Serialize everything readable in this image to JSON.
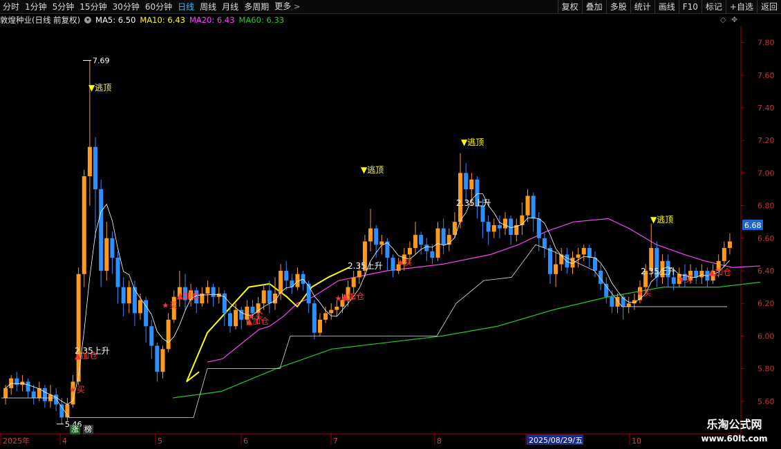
{
  "toolbar": {
    "tabs": [
      {
        "label": "分时",
        "active": false
      },
      {
        "label": "1分钟",
        "active": false
      },
      {
        "label": "5分钟",
        "active": false
      },
      {
        "label": "15分钟",
        "active": false
      },
      {
        "label": "30分钟",
        "active": false
      },
      {
        "label": "60分钟",
        "active": false
      },
      {
        "label": "日线",
        "active": true
      },
      {
        "label": "周线",
        "active": false
      },
      {
        "label": "月线",
        "active": false
      },
      {
        "label": "多周期",
        "active": false
      },
      {
        "label": "更多",
        "active": false
      }
    ],
    "tools": [
      "复权",
      "叠加",
      "多股",
      "统计",
      "画线",
      "F10",
      "标记",
      "+自选",
      "返回"
    ]
  },
  "info": {
    "stock_title": "敦煌种业(日线 前复权)",
    "ma5": "MA5: 6.50",
    "ma10": "MA10: 6.43",
    "ma20": "MA20: 6.43",
    "ma60": "MA60: 6.33"
  },
  "colors": {
    "up": "#ff9a1a",
    "down": "#2e8fff",
    "ma5": "#ffffff",
    "ma10": "#ffff00",
    "ma20": "#ff44ff",
    "ma60": "#22cc22",
    "axis": "#aa0000",
    "signal_red": "#ff3333",
    "signal_yellow": "#ffff00",
    "price_tag": "#1a66cc"
  },
  "chart_data": {
    "type": "candlestick",
    "ylim": [
      5.4,
      7.9
    ],
    "yticks": [
      "7.80",
      "7.60",
      "7.40",
      "7.20",
      "7.00",
      "6.80",
      "6.60",
      "6.40",
      "6.20",
      "6.00",
      "5.80",
      "5.60"
    ],
    "xlabels": [
      "2025年",
      "4",
      "5",
      "6",
      "7",
      "8",
      "9",
      "10"
    ],
    "highlight_date": "2025/08/29/五",
    "current_price": "6.68",
    "high_annotation": "7.69",
    "low_annotation": "5.46",
    "candles_ohlc": [
      [
        5.62,
        5.68,
        5.58,
        5.7
      ],
      [
        5.68,
        5.74,
        5.64,
        5.76
      ],
      [
        5.74,
        5.7,
        5.66,
        5.78
      ],
      [
        5.7,
        5.72,
        5.66,
        5.76
      ],
      [
        5.72,
        5.66,
        5.62,
        5.74
      ],
      [
        5.66,
        5.62,
        5.58,
        5.7
      ],
      [
        5.62,
        5.68,
        5.6,
        5.72
      ],
      [
        5.68,
        5.6,
        5.56,
        5.7
      ],
      [
        5.6,
        5.64,
        5.56,
        5.7
      ],
      [
        5.64,
        5.58,
        5.54,
        5.68
      ],
      [
        5.58,
        5.5,
        5.46,
        5.62
      ],
      [
        5.5,
        5.58,
        5.48,
        5.62
      ],
      [
        5.58,
        5.72,
        5.56,
        5.76
      ],
      [
        5.72,
        6.38,
        5.7,
        6.42
      ],
      [
        6.38,
        6.98,
        6.3,
        7.02
      ],
      [
        6.98,
        7.16,
        6.8,
        7.69
      ],
      [
        7.16,
        6.9,
        6.6,
        7.22
      ],
      [
        6.9,
        6.4,
        6.3,
        6.96
      ],
      [
        6.4,
        6.6,
        6.34,
        6.7
      ],
      [
        6.6,
        6.48,
        6.38,
        6.64
      ],
      [
        6.48,
        6.3,
        6.2,
        6.52
      ],
      [
        6.3,
        6.2,
        6.12,
        6.36
      ],
      [
        6.2,
        6.3,
        6.14,
        6.34
      ],
      [
        6.3,
        6.14,
        6.06,
        6.34
      ],
      [
        6.14,
        6.22,
        6.1,
        6.26
      ],
      [
        6.22,
        6.06,
        5.96,
        6.24
      ],
      [
        6.06,
        5.94,
        5.86,
        6.1
      ],
      [
        5.94,
        5.78,
        5.72,
        5.96
      ],
      [
        5.78,
        5.92,
        5.74,
        5.94
      ],
      [
        5.92,
        6.1,
        5.9,
        6.14
      ],
      [
        6.1,
        6.24,
        6.08,
        6.28
      ],
      [
        6.24,
        6.3,
        6.18,
        6.4
      ],
      [
        6.3,
        6.22,
        6.16,
        6.38
      ],
      [
        6.22,
        6.28,
        6.18,
        6.32
      ],
      [
        6.28,
        6.2,
        6.14,
        6.3
      ],
      [
        6.2,
        6.26,
        6.18,
        6.3
      ],
      [
        6.26,
        6.3,
        6.2,
        6.34
      ],
      [
        6.3,
        6.24,
        6.18,
        6.32
      ],
      [
        6.24,
        6.26,
        6.2,
        6.3
      ],
      [
        6.26,
        6.14,
        6.06,
        6.28
      ],
      [
        6.14,
        6.06,
        6.02,
        6.18
      ],
      [
        6.06,
        6.16,
        6.04,
        6.2
      ],
      [
        6.16,
        6.1,
        6.04,
        6.18
      ],
      [
        6.1,
        6.18,
        6.08,
        6.22
      ],
      [
        6.18,
        6.14,
        6.1,
        6.22
      ],
      [
        6.14,
        6.2,
        6.1,
        6.24
      ],
      [
        6.2,
        6.28,
        6.16,
        6.32
      ],
      [
        6.28,
        6.2,
        6.14,
        6.34
      ],
      [
        6.2,
        6.26,
        6.16,
        6.36
      ],
      [
        6.26,
        6.4,
        6.22,
        6.44
      ],
      [
        6.4,
        6.34,
        6.28,
        6.46
      ],
      [
        6.34,
        6.3,
        6.26,
        6.38
      ],
      [
        6.3,
        6.38,
        6.28,
        6.42
      ],
      [
        6.38,
        6.32,
        6.28,
        6.4
      ],
      [
        6.32,
        6.2,
        6.14,
        6.34
      ],
      [
        6.2,
        6.02,
        5.98,
        6.22
      ],
      [
        6.02,
        6.1,
        6.0,
        6.14
      ],
      [
        6.1,
        6.14,
        6.08,
        6.18
      ],
      [
        6.14,
        6.16,
        6.1,
        6.2
      ],
      [
        6.16,
        6.18,
        6.12,
        6.22
      ],
      [
        6.18,
        6.22,
        6.14,
        6.26
      ],
      [
        6.22,
        6.3,
        6.18,
        6.34
      ],
      [
        6.3,
        6.36,
        6.26,
        6.4
      ],
      [
        6.36,
        6.4,
        6.32,
        6.44
      ],
      [
        6.4,
        6.58,
        6.36,
        6.62
      ],
      [
        6.58,
        6.66,
        6.52,
        6.78
      ],
      [
        6.66,
        6.56,
        6.48,
        6.68
      ],
      [
        6.56,
        6.58,
        6.5,
        6.62
      ],
      [
        6.58,
        6.48,
        6.4,
        6.6
      ],
      [
        6.48,
        6.4,
        6.36,
        6.5
      ],
      [
        6.4,
        6.44,
        6.38,
        6.48
      ],
      [
        6.44,
        6.5,
        6.4,
        6.54
      ],
      [
        6.5,
        6.54,
        6.44,
        6.58
      ],
      [
        6.54,
        6.62,
        6.5,
        6.7
      ],
      [
        6.62,
        6.56,
        6.5,
        6.64
      ],
      [
        6.56,
        6.52,
        6.46,
        6.6
      ],
      [
        6.52,
        6.48,
        6.44,
        6.56
      ],
      [
        6.48,
        6.66,
        6.46,
        6.7
      ],
      [
        6.66,
        6.56,
        6.5,
        6.72
      ],
      [
        6.56,
        6.62,
        6.52,
        6.66
      ],
      [
        6.62,
        6.7,
        6.6,
        6.76
      ],
      [
        6.7,
        7.0,
        6.66,
        7.12
      ],
      [
        7.0,
        6.9,
        6.82,
        7.06
      ],
      [
        6.9,
        6.96,
        6.8,
        7.0
      ],
      [
        6.96,
        6.8,
        6.72,
        6.98
      ],
      [
        6.8,
        6.7,
        6.6,
        6.84
      ],
      [
        6.7,
        6.64,
        6.56,
        6.74
      ],
      [
        6.64,
        6.68,
        6.6,
        6.72
      ],
      [
        6.68,
        6.66,
        6.6,
        6.74
      ],
      [
        6.66,
        6.72,
        6.62,
        6.76
      ],
      [
        6.72,
        6.62,
        6.56,
        6.74
      ],
      [
        6.62,
        6.68,
        6.58,
        6.72
      ],
      [
        6.68,
        6.74,
        6.62,
        6.82
      ],
      [
        6.74,
        6.86,
        6.7,
        6.9
      ],
      [
        6.86,
        6.72,
        6.64,
        6.88
      ],
      [
        6.72,
        6.6,
        6.52,
        6.76
      ],
      [
        6.6,
        6.54,
        6.48,
        6.64
      ],
      [
        6.54,
        6.38,
        6.32,
        6.56
      ],
      [
        6.38,
        6.44,
        6.3,
        6.52
      ],
      [
        6.44,
        6.5,
        6.4,
        6.54
      ],
      [
        6.5,
        6.42,
        6.38,
        6.54
      ],
      [
        6.42,
        6.48,
        6.38,
        6.52
      ],
      [
        6.48,
        6.5,
        6.42,
        6.54
      ],
      [
        6.5,
        6.54,
        6.46,
        6.56
      ],
      [
        6.54,
        6.48,
        6.42,
        6.56
      ],
      [
        6.48,
        6.4,
        6.36,
        6.52
      ],
      [
        6.4,
        6.32,
        6.28,
        6.44
      ],
      [
        6.32,
        6.24,
        6.2,
        6.36
      ],
      [
        6.24,
        6.18,
        6.14,
        6.28
      ],
      [
        6.18,
        6.24,
        6.14,
        6.26
      ],
      [
        6.24,
        6.18,
        6.1,
        6.26
      ],
      [
        6.18,
        6.2,
        6.14,
        6.24
      ],
      [
        6.2,
        6.22,
        6.16,
        6.26
      ],
      [
        6.22,
        6.3,
        6.2,
        6.34
      ],
      [
        6.3,
        6.4,
        6.26,
        6.44
      ],
      [
        6.4,
        6.54,
        6.36,
        6.69
      ],
      [
        6.54,
        6.36,
        6.3,
        6.58
      ],
      [
        6.36,
        6.46,
        6.32,
        6.5
      ],
      [
        6.46,
        6.36,
        6.3,
        6.5
      ],
      [
        6.36,
        6.32,
        6.28,
        6.4
      ],
      [
        6.32,
        6.38,
        6.3,
        6.42
      ],
      [
        6.38,
        6.34,
        6.3,
        6.44
      ],
      [
        6.34,
        6.4,
        6.32,
        6.44
      ],
      [
        6.4,
        6.36,
        6.32,
        6.42
      ],
      [
        6.36,
        6.4,
        6.32,
        6.44
      ],
      [
        6.4,
        6.34,
        6.3,
        6.42
      ],
      [
        6.34,
        6.4,
        6.32,
        6.44
      ],
      [
        6.4,
        6.46,
        6.36,
        6.5
      ],
      [
        6.46,
        6.54,
        6.42,
        6.58
      ],
      [
        6.54,
        6.58,
        6.5,
        6.63
      ]
    ],
    "ma5_line": [
      [
        5.56,
        5.64
      ],
      [
        5.88,
        5.72
      ],
      [
        6.2,
        5.66
      ],
      [
        6.34,
        5.62
      ],
      [
        7.6,
        7.02
      ],
      [
        6.02,
        6.16
      ],
      [
        6.3,
        6.18
      ],
      [
        6.7,
        6.3
      ],
      [
        7.2,
        6.26
      ],
      [
        7.36,
        6.18
      ],
      [
        7.5,
        6.4
      ],
      [
        7.0,
        6.44
      ],
      [
        6.56,
        6.6
      ],
      [
        7.3,
        6.46
      ],
      [
        6.9,
        6.6
      ],
      [
        7.34,
        6.4
      ],
      [
        7.44,
        6.52
      ],
      [
        7.7,
        6.24
      ],
      [
        8.12,
        6.2
      ],
      [
        8.4,
        6.26
      ],
      [
        8.56,
        6.36
      ],
      [
        8.9,
        6.4
      ],
      [
        9.2,
        6.48
      ],
      [
        9.64,
        6.42
      ],
      [
        9.84,
        6.44
      ],
      [
        10.02,
        6.48
      ]
    ],
    "ma10_line": [
      [
        5.76,
        5.78
      ],
      [
        5.4,
        5.72
      ],
      [
        6.0,
        6.02
      ],
      [
        7.2,
        6.3
      ],
      [
        7.8,
        6.32
      ],
      [
        8.3,
        6.24
      ],
      [
        8.6,
        6.18
      ],
      [
        9.02,
        6.3
      ],
      [
        9.5,
        6.36
      ],
      [
        10.1,
        6.42
      ]
    ],
    "ma20_line": [
      [
        6.0,
        5.84
      ],
      [
        6.44,
        5.86
      ],
      [
        7.5,
        6.04
      ],
      [
        7.8,
        6.06
      ],
      [
        8.2,
        6.12
      ],
      [
        8.6,
        6.2
      ],
      [
        9.06,
        6.24
      ],
      [
        9.8,
        6.34
      ],
      [
        11.2,
        6.4
      ],
      [
        12.8,
        6.44
      ],
      [
        14.2,
        6.5
      ],
      [
        15.0,
        6.56
      ],
      [
        15.8,
        6.64
      ],
      [
        16.6,
        6.7
      ],
      [
        17.6,
        6.72
      ],
      [
        18.2,
        6.66
      ],
      [
        19.0,
        6.56
      ],
      [
        19.8,
        6.5
      ],
      [
        20.4,
        6.46
      ],
      [
        21.2,
        6.42
      ],
      [
        22.0,
        6.43
      ]
    ],
    "ma60_line": [
      [
        5.0,
        5.62
      ],
      [
        6.4,
        5.66
      ],
      [
        8.0,
        5.8
      ],
      [
        9.6,
        5.92
      ],
      [
        11.2,
        5.96
      ],
      [
        12.8,
        6.0
      ],
      [
        14.4,
        6.06
      ],
      [
        16.0,
        6.16
      ],
      [
        17.6,
        6.24
      ],
      [
        19.2,
        6.3
      ],
      [
        20.8,
        6.3
      ],
      [
        22.0,
        6.33
      ]
    ],
    "signal_labels": [
      {
        "text": "▼逃顶",
        "kind": "top"
      },
      {
        "text": "▼逃顶",
        "kind": "top"
      },
      {
        "text": "▼逃顶",
        "kind": "top"
      },
      {
        "text": "▼逃顶",
        "kind": "top"
      },
      {
        "text": "2.35上升",
        "kind": "rise"
      },
      {
        "text": "2.35上升",
        "kind": "rise"
      },
      {
        "text": "2.35上升",
        "kind": "rise"
      },
      {
        "text": "2.35上升",
        "kind": "rise"
      },
      {
        "text": "★买",
        "kind": "buy"
      },
      {
        "text": "★买",
        "kind": "buy"
      },
      {
        "text": "★买",
        "kind": "buy"
      },
      {
        "text": "★买",
        "kind": "buy"
      },
      {
        "text": "★买",
        "kind": "buy"
      },
      {
        "text": "★买",
        "kind": "buy"
      },
      {
        "text": "★买",
        "kind": "buy"
      },
      {
        "text": "▲加仓",
        "kind": "add"
      },
      {
        "text": "▲加仓",
        "kind": "add"
      },
      {
        "text": "▲加仓",
        "kind": "add"
      },
      {
        "text": "▲加仓",
        "kind": "add"
      },
      {
        "text": "▲加仓",
        "kind": "add"
      }
    ]
  },
  "bottom_badges": [
    {
      "text": "涨",
      "style": "green"
    },
    {
      "text": "榜",
      "style": "dark"
    }
  ],
  "watermark": {
    "line1": "乐淘公式网",
    "line2": "www.60lt.com"
  }
}
